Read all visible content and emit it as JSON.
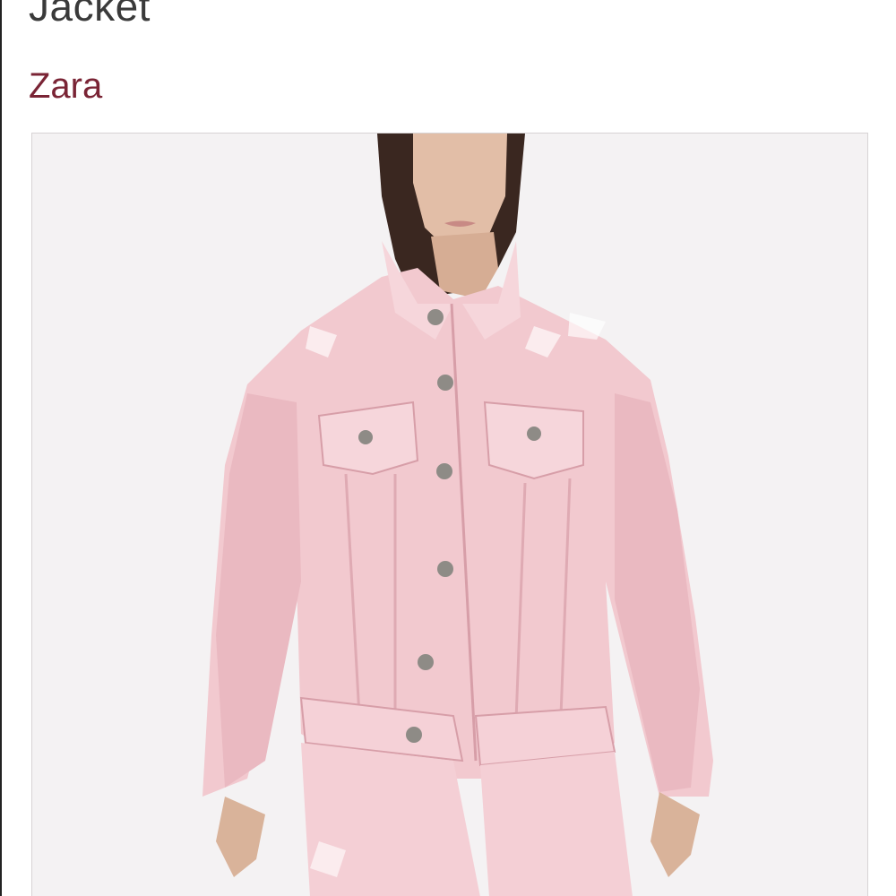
{
  "product": {
    "title": "Jacket",
    "brand": "Zara"
  },
  "image": {
    "subject": "model-wearing-pink-distressed-denim-jacket",
    "colors": {
      "background": "#f4f2f3",
      "jacket": "#f2c9cf",
      "jacket_shadow": "#e7b4bc",
      "skin": "#d9b39a",
      "hair": "#3a2720",
      "button": "#8e8b86"
    }
  }
}
